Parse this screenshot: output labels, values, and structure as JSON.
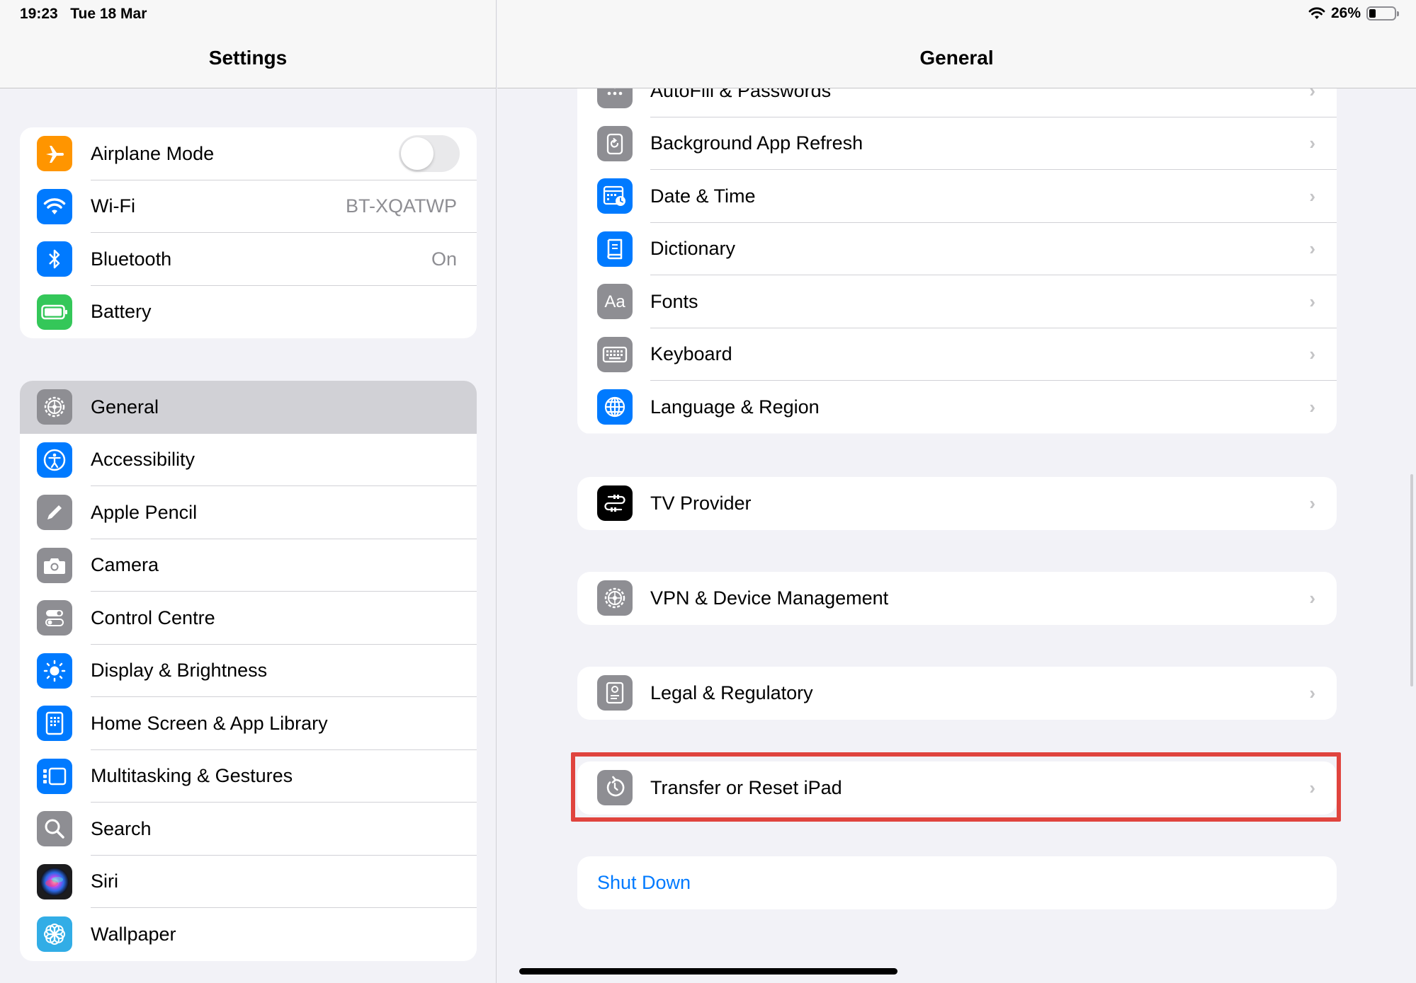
{
  "status_bar": {
    "time": "19:23",
    "date": "Tue 18 Mar",
    "battery_percent_text": "26%",
    "battery_level": 0.26,
    "wifi_icon": "wifi-icon"
  },
  "sidebar": {
    "title": "Settings",
    "group1": [
      {
        "label": "Airplane Mode",
        "icon": "airplane-icon",
        "color": "#ff9500",
        "toggle": false
      },
      {
        "label": "Wi-Fi",
        "icon": "wifi-icon",
        "color": "#007aff",
        "value": "BT-XQATWP"
      },
      {
        "label": "Bluetooth",
        "icon": "bluetooth-icon",
        "color": "#007aff",
        "value": "On"
      },
      {
        "label": "Battery",
        "icon": "battery-icon",
        "color": "#34c759"
      }
    ],
    "group2": [
      {
        "label": "General",
        "icon": "gear-icon",
        "color": "#8e8e93",
        "selected": true
      },
      {
        "label": "Accessibility",
        "icon": "accessibility-icon",
        "color": "#007aff"
      },
      {
        "label": "Apple Pencil",
        "icon": "pencil-icon",
        "color": "#8e8e93"
      },
      {
        "label": "Camera",
        "icon": "camera-icon",
        "color": "#8e8e93"
      },
      {
        "label": "Control Centre",
        "icon": "control-centre-icon",
        "color": "#8e8e93"
      },
      {
        "label": "Display & Brightness",
        "icon": "brightness-icon",
        "color": "#007aff"
      },
      {
        "label": "Home Screen & App Library",
        "icon": "home-screen-icon",
        "color": "#007aff"
      },
      {
        "label": "Multitasking & Gestures",
        "icon": "multitasking-icon",
        "color": "#007aff"
      },
      {
        "label": "Search",
        "icon": "search-icon",
        "color": "#8e8e93"
      },
      {
        "label": "Siri",
        "icon": "siri-icon",
        "color": "#1c1c1e"
      },
      {
        "label": "Wallpaper",
        "icon": "wallpaper-icon",
        "color": "#32ade6"
      }
    ]
  },
  "detail": {
    "title": "General",
    "group1": [
      {
        "label": "AutoFill & Passwords",
        "icon": "autofill-icon",
        "color": "#8e8e93"
      },
      {
        "label": "Background App Refresh",
        "icon": "refresh-icon",
        "color": "#8e8e93"
      },
      {
        "label": "Date & Time",
        "icon": "calendar-clock-icon",
        "color": "#007aff"
      },
      {
        "label": "Dictionary",
        "icon": "dictionary-icon",
        "color": "#007aff"
      },
      {
        "label": "Fonts",
        "icon": "fonts-icon",
        "color": "#8e8e93",
        "glyph": "Aa"
      },
      {
        "label": "Keyboard",
        "icon": "keyboard-icon",
        "color": "#8e8e93"
      },
      {
        "label": "Language & Region",
        "icon": "globe-icon",
        "color": "#007aff"
      }
    ],
    "tv_provider": {
      "label": "TV Provider",
      "icon": "tv-provider-icon",
      "color": "#000000"
    },
    "vpn": {
      "label": "VPN & Device Management",
      "icon": "gear-icon",
      "color": "#8e8e93"
    },
    "legal": {
      "label": "Legal & Regulatory",
      "icon": "legal-icon",
      "color": "#8e8e93"
    },
    "transfer": {
      "label": "Transfer or Reset iPad",
      "icon": "reset-icon",
      "color": "#8e8e93",
      "highlight_color": "#e0443e"
    },
    "shutdown": {
      "label": "Shut Down",
      "color": "#007aff"
    }
  }
}
